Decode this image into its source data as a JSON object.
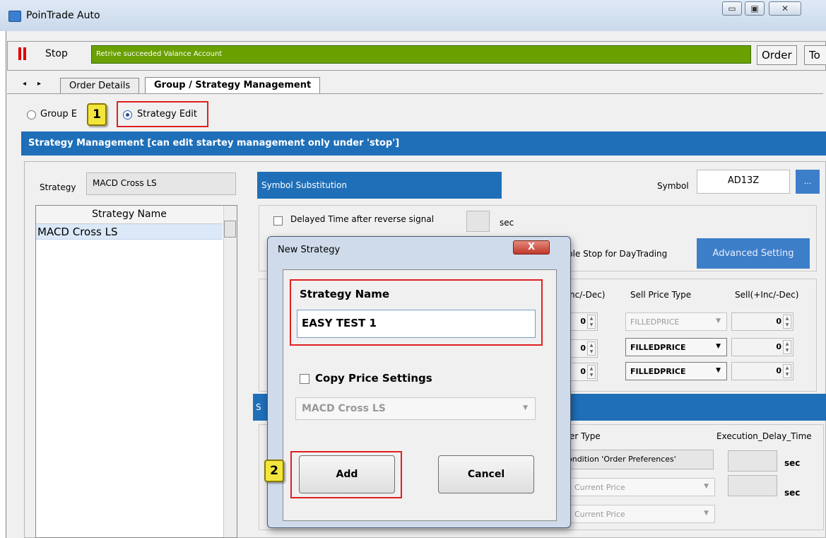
{
  "window": {
    "title": "PoinTrade Auto",
    "controls": [
      "▭",
      "▣",
      "✕"
    ]
  },
  "toolbar": {
    "stop_label": "Stop",
    "status": "Retrive succeeded Valance Account",
    "order_label": "Order",
    "to_label": "To"
  },
  "tabs": {
    "nav_left": "◂",
    "nav_right": "▸",
    "items": [
      "Order Details",
      "Group / Strategy Management"
    ]
  },
  "mode": {
    "group_edit": "Group E",
    "strategy_edit": "Strategy Edit"
  },
  "header": "Strategy Management [can edit startey management only under 'stop']",
  "left": {
    "strategy_label": "Strategy",
    "strategy_value": "MACD Cross LS",
    "col_header": "Strategy Name",
    "rows": [
      "MACD Cross LS"
    ]
  },
  "right": {
    "symbol_sub": "Symbol Substitution",
    "symbol_label": "Symbol",
    "symbol_value": "AD13Z",
    "browse": "...",
    "delayed_label": "Delayed Time after reverse  signal",
    "sec": "sec",
    "stop_daytrading": "ble Stop for DayTrading",
    "advanced": "Advanced Setting",
    "col_inc": "nc/-Dec)",
    "col_sell_type": "Sell Price Type",
    "col_sell_inc": "Sell(+Inc/-Dec)",
    "spin_value": "0",
    "sell_types": [
      "FILLEDPRICE",
      "FILLEDPRICE",
      "FILLEDPRICE"
    ],
    "section2_s": "S",
    "order_type_label": "er Type",
    "exec_delay_label": "Execution_Delay_Time",
    "condition_text": "ondition 'Order Preferences'",
    "current_price": "Current Price"
  },
  "dialog": {
    "title": "New Strategy",
    "close": "X",
    "name_label": "Strategy Name",
    "name_value": "EASY TEST 1",
    "copy_label": "Copy Price Settings",
    "copy_select": "MACD Cross LS",
    "add": "Add",
    "cancel": "Cancel"
  },
  "badges": {
    "one": "1",
    "two": "2"
  }
}
